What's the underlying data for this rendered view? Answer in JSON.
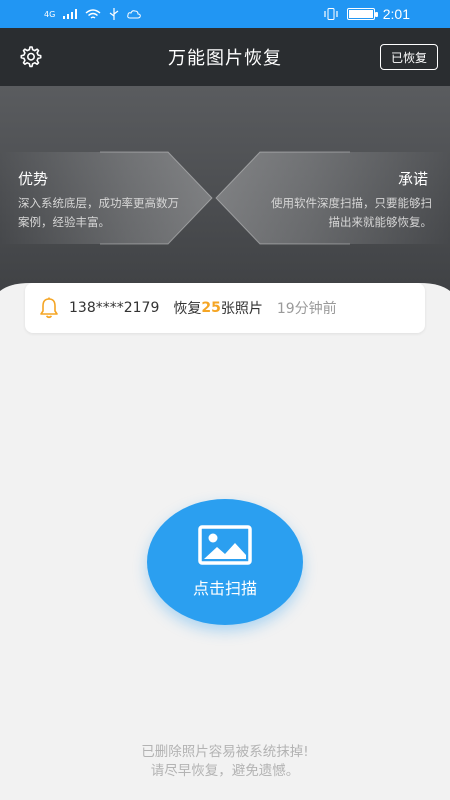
{
  "status_bar": {
    "network": "4G",
    "time": "2:01",
    "battery_level": 0.95
  },
  "header": {
    "title": "万能图片恢复",
    "recovered_button": "已恢复",
    "settings_icon": "gear-icon"
  },
  "hero": {
    "advantage_title": "优势",
    "advantage_desc": "深入系统底层，成功率更高数万案例，经验丰富。",
    "promise_title": "承诺",
    "promise_desc": "使用软件深度扫描，只要能够扫描出来就能够恢复。"
  },
  "notification": {
    "icon": "bell-icon",
    "phone": "138****2179",
    "prefix": "恢复",
    "count": "25",
    "suffix": "张照片",
    "time_ago": "19分钟前"
  },
  "scan": {
    "icon": "image-icon",
    "label": "点击扫描"
  },
  "footer": {
    "line1": "已删除照片容易被系统抹掉!",
    "line2": "请尽早恢复，避免遗憾。"
  },
  "colors": {
    "status_bar": "#2196f3",
    "header": "#2a2d30",
    "accent": "#2b9ff0",
    "highlight": "#f5a524"
  }
}
